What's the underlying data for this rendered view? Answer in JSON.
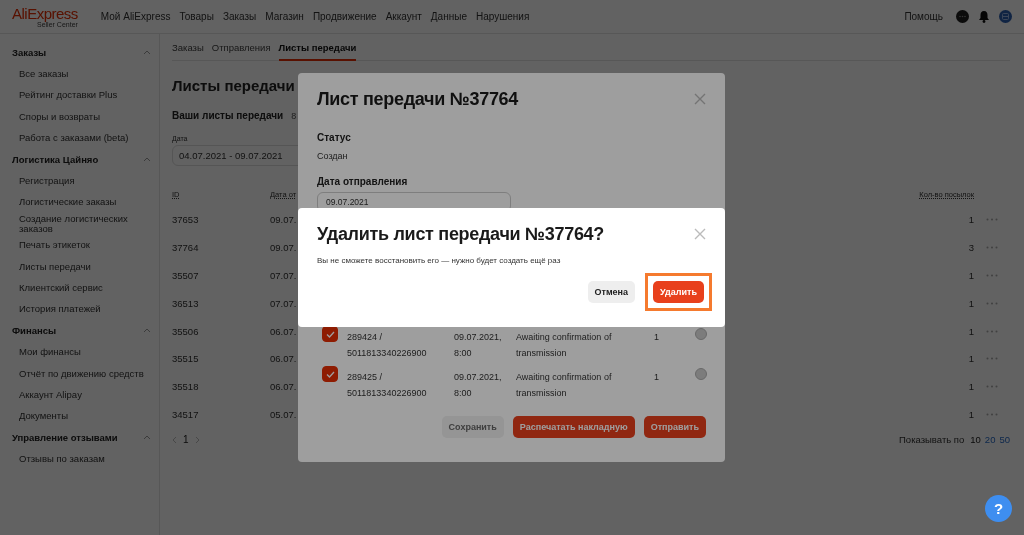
{
  "header": {
    "logo": {
      "name": "AliExpress",
      "subtitle": "Seller Center"
    },
    "nav": [
      "Мой AliExpress",
      "Товары",
      "Заказы",
      "Магазин",
      "Продвижение",
      "Аккаунт",
      "Данные",
      "Нарушения"
    ],
    "help": "Помощь"
  },
  "sidebar": {
    "groups": [
      {
        "title": "Заказы",
        "expanded": true,
        "items": [
          "Все заказы",
          "Рейтинг доставки Plus",
          "Споры и возвраты",
          "Работа с заказами (beta)"
        ]
      },
      {
        "title": "Логистика Цайняо",
        "expanded": true,
        "items": [
          "Регистрация",
          "Логистические заказы",
          "Создание логистических заказов",
          "Печать этикеток",
          "Листы передачи",
          "Клиентский сервис",
          "История платежей"
        ]
      },
      {
        "title": "Финансы",
        "expanded": true,
        "items": [
          "Мои финансы",
          "Отчёт по движению средств",
          "Аккаунт Alipay",
          "Документы"
        ]
      },
      {
        "title": "Управление отзывами",
        "expanded": true,
        "items": [
          "Отзывы по заказам"
        ]
      }
    ]
  },
  "tabs": [
    {
      "label": "Заказы",
      "selected": false
    },
    {
      "label": "Отправления",
      "selected": false
    },
    {
      "label": "Листы передачи",
      "selected": true
    }
  ],
  "page_title": "Листы передачи",
  "section": {
    "title": "Ваши листы передачи",
    "count": "8"
  },
  "date_filter": {
    "label": "Дата",
    "value": "04.07.2021 - 09.07.2021"
  },
  "table": {
    "columns": [
      "ID",
      "Дата от",
      "Кол-во посылок"
    ],
    "rows": [
      {
        "id": "37653",
        "date": "09.07.",
        "count": "1"
      },
      {
        "id": "37764",
        "date": "09.07.",
        "count": "3"
      },
      {
        "id": "35507",
        "date": "07.07.",
        "count": "1"
      },
      {
        "id": "36513",
        "date": "07.07.",
        "count": "1"
      },
      {
        "id": "35506",
        "date": "06.07.",
        "count": "1"
      },
      {
        "id": "35515",
        "date": "06.07.",
        "count": "1"
      },
      {
        "id": "35518",
        "date": "06.07.",
        "count": "1"
      },
      {
        "id": "34517",
        "date": "05.07.",
        "count": "1"
      }
    ]
  },
  "pagination": {
    "pages": [
      {
        "label": "1",
        "selected": true
      }
    ]
  },
  "page_size": {
    "label": "Показывать по",
    "options": [
      {
        "label": "10",
        "selected": true
      },
      {
        "label": "20",
        "selected": false
      },
      {
        "label": "50",
        "selected": false
      }
    ]
  },
  "help_button": "?",
  "sheet_dialog": {
    "title": "Лист передачи №37764",
    "status_label": "Статус",
    "status": "Создан",
    "date_label": "Дата отправления",
    "date_value": "09.07.2021",
    "parcels": [
      {
        "checked": true,
        "id": "289424 / 5011813340226900",
        "date": "09.07.2021, 8:00",
        "status": "Awaiting confirmation of transmission",
        "count": "1"
      },
      {
        "checked": true,
        "id": "289425 / 5011813340226900",
        "date": "09.07.2021, 8:00",
        "status": "Awaiting confirmation of transmission",
        "count": "1"
      }
    ],
    "buttons": [
      {
        "label": "Сохранить",
        "disabled": true
      },
      {
        "label": "Распечатать накладную",
        "disabled": false
      },
      {
        "label": "Отправить",
        "disabled": false
      }
    ]
  },
  "confirm_dialog": {
    "title": "Удалить лист передачи №37764?",
    "message": "Вы не сможете восстановить его — нужно будет создать ещё раз",
    "buttons": [
      {
        "label": "Отмена",
        "kind": "secondary",
        "highlighted": false
      },
      {
        "label": "Удалить",
        "kind": "danger",
        "highlighted": true
      }
    ]
  }
}
